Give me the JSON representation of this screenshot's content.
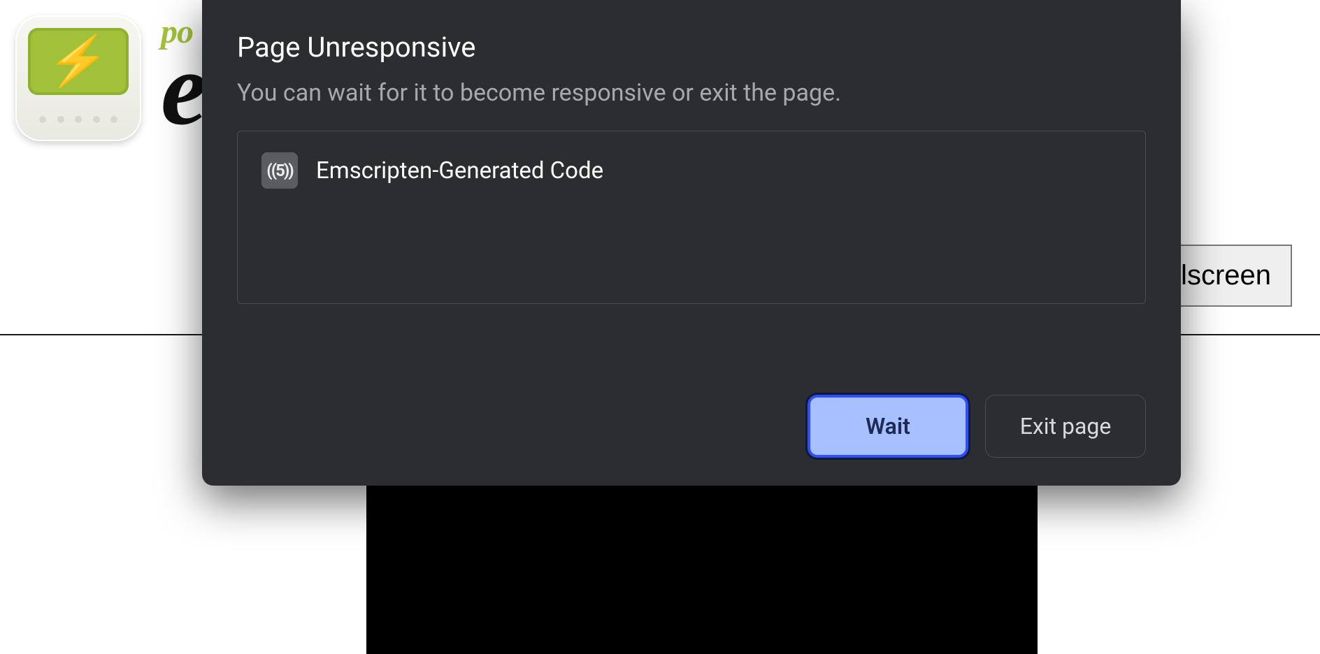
{
  "page": {
    "brand_small": "po",
    "brand_large": "e",
    "fullscreen_label": "Fullscreen"
  },
  "dialog": {
    "title": "Page Unresponsive",
    "subtitle": "You can wait for it to become responsive or exit the page.",
    "tab": {
      "favicon_label": "((5))",
      "name": "Emscripten-Generated Code"
    },
    "buttons": {
      "wait": "Wait",
      "exit": "Exit page"
    }
  }
}
